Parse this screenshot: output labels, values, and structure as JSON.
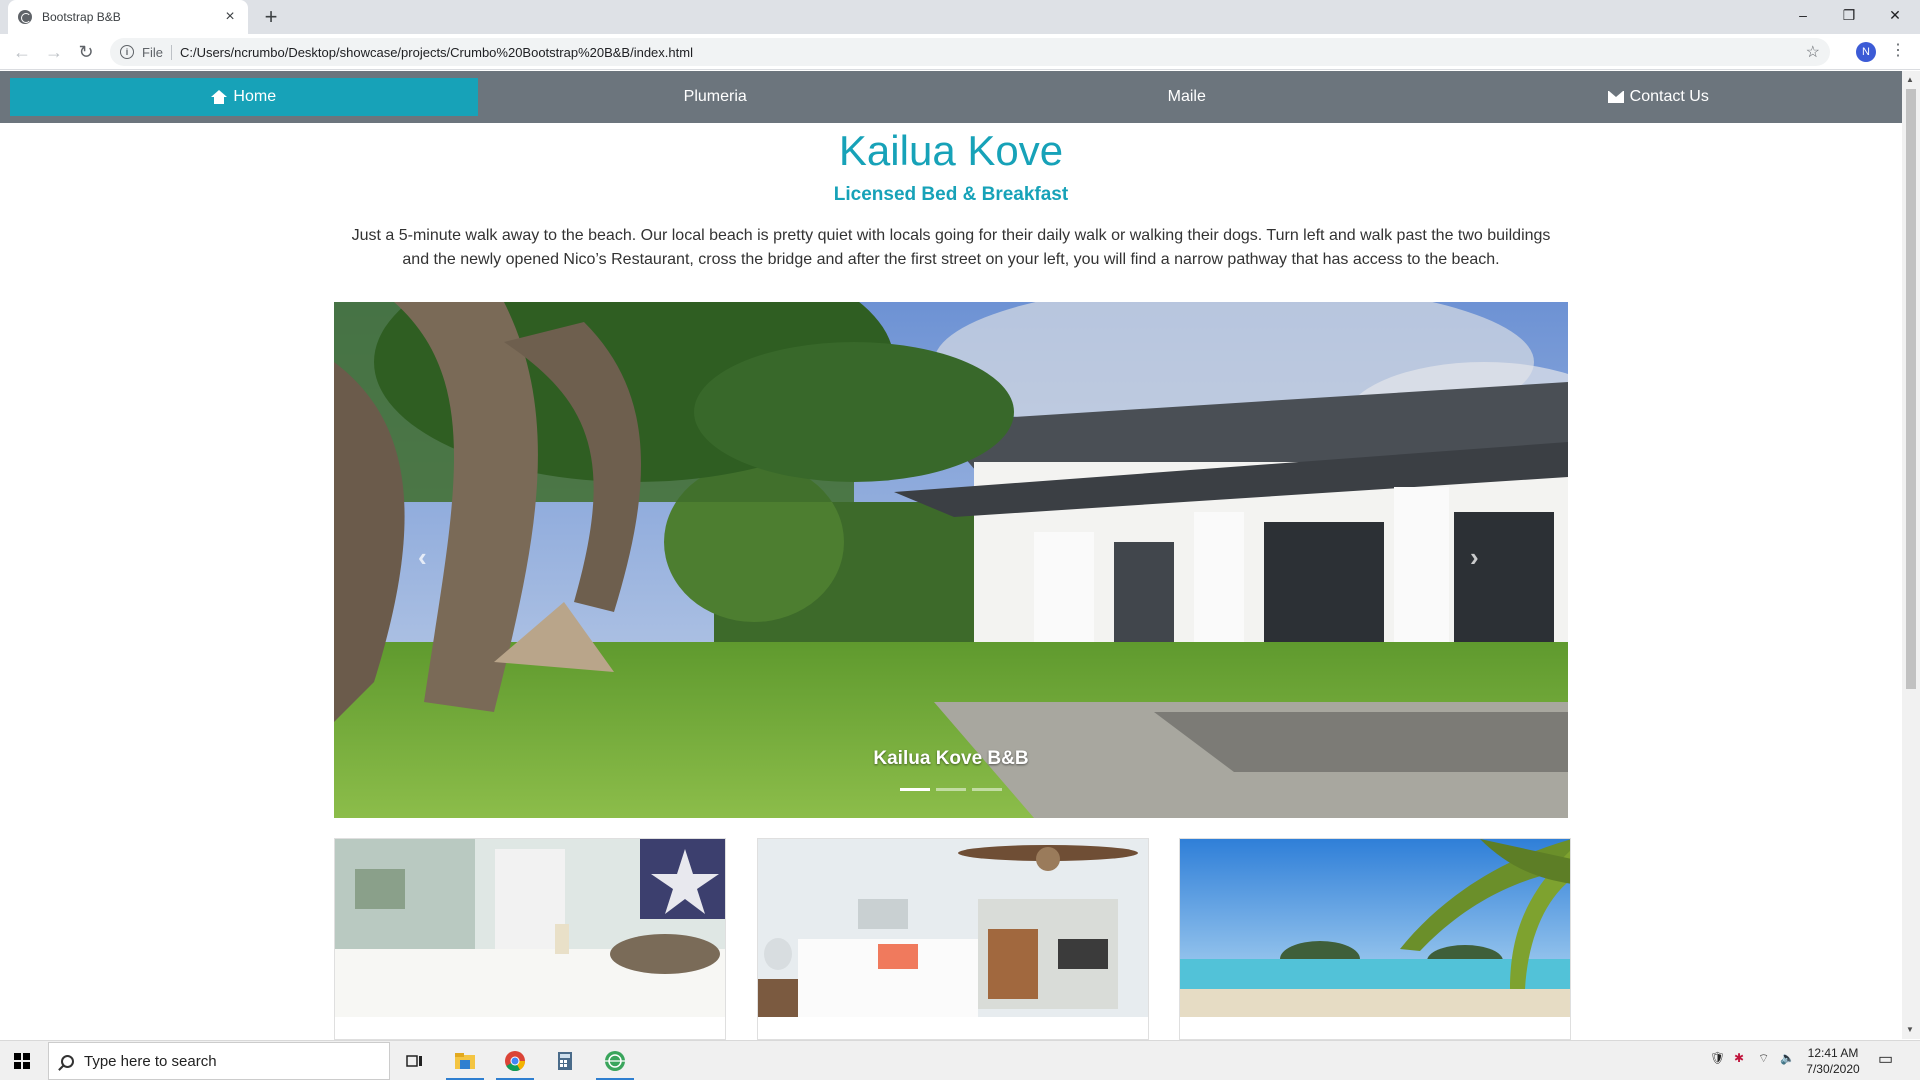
{
  "browser": {
    "tab_title": "Bootstrap B&B",
    "tab_close": "×",
    "new_tab": "+",
    "scheme": "File",
    "url": "C:/Users/ncrumbo/Desktop/showcase/projects/Crumbo%20Bootstrap%20B&B/index.html",
    "profile_initial": "N",
    "window_controls": [
      "–",
      "❐",
      "✕"
    ]
  },
  "nav": {
    "items": [
      {
        "label": "Home",
        "icon": "home-icon",
        "active": true
      },
      {
        "label": "Plumeria",
        "active": false
      },
      {
        "label": "Maile",
        "active": false
      },
      {
        "label": "Contact Us",
        "icon": "envelope-icon",
        "active": false
      }
    ]
  },
  "hero": {
    "title": "Kailua Kove",
    "subtitle": "Licensed Bed & Breakfast",
    "description": "Just a 5-minute walk away to the beach. Our local beach is pretty quiet with locals going for their daily walk or walking their dogs. Turn left and walk past the two buildings and the newly opened Nico’s Restaurant, cross the bridge and after the first street on your left, you will find a narrow pathway that has access to the beach."
  },
  "carousel": {
    "caption": "Kailua Kove B&B",
    "prev": "‹",
    "next": "›",
    "slide_count": 3,
    "active_slide": 1
  },
  "cards": [
    {
      "image": "bedroom-starfish"
    },
    {
      "image": "bedroom-ceiling-fan"
    },
    {
      "image": "beach-palm"
    }
  ],
  "taskbar": {
    "search_placeholder": "Type here to search",
    "time": "12:41 AM",
    "date": "7/30/2020"
  },
  "colors": {
    "accent": "#17a2b8",
    "nav_bg": "#6c757d"
  }
}
